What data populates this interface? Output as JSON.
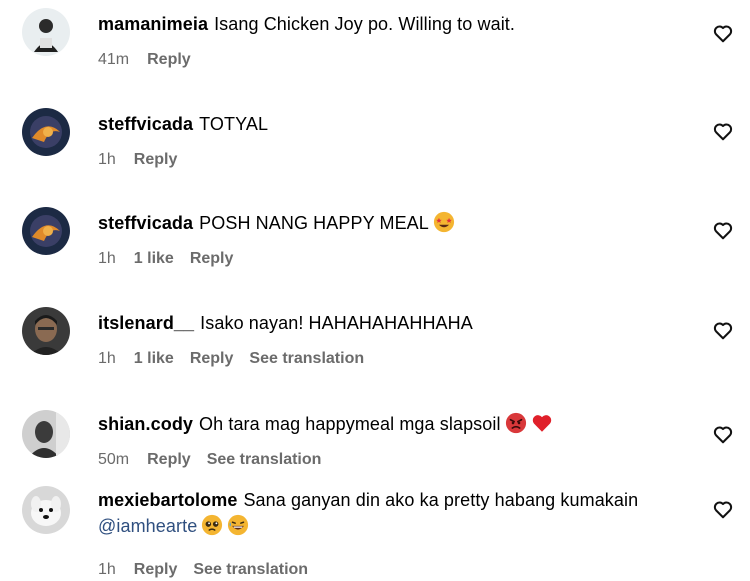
{
  "comments": [
    {
      "username": "mamanimeia",
      "text": "Isang Chicken Joy po. Willing to wait.",
      "time": "41m",
      "reply": "Reply"
    },
    {
      "username": "steffvicada",
      "text": "TOTYAL",
      "time": "1h",
      "reply": "Reply"
    },
    {
      "username": "steffvicada",
      "text": "POSH NANG HAPPY MEAL",
      "time": "1h",
      "likes": "1 like",
      "reply": "Reply",
      "emoji": [
        "star-struck-emoji"
      ]
    },
    {
      "username": "itslenard__",
      "text": "Isako nayan! HAHAHAHAHHAHA",
      "time": "1h",
      "likes": "1 like",
      "reply": "Reply",
      "translate": "See translation"
    },
    {
      "username": "shian.cody",
      "text": "Oh tara mag happymeal mga slapsoil",
      "time": "50m",
      "reply": "Reply",
      "translate": "See translation",
      "emoji": [
        "angry-face-emoji",
        "red-heart-emoji"
      ]
    },
    {
      "username": "mexiebartolome",
      "text": "Sana ganyan din ako ka pretty habang kumakain",
      "mention": "@iamhearte",
      "time": "1h",
      "reply": "Reply",
      "translate": "See translation",
      "emoji": [
        "pleading-face-emoji",
        "grinning-sweat-emoji"
      ]
    }
  ],
  "colors": {
    "text": "#000000",
    "meta": "#6b6b6b",
    "mention": "#2f4f7f",
    "heart_outline": "#111111"
  }
}
